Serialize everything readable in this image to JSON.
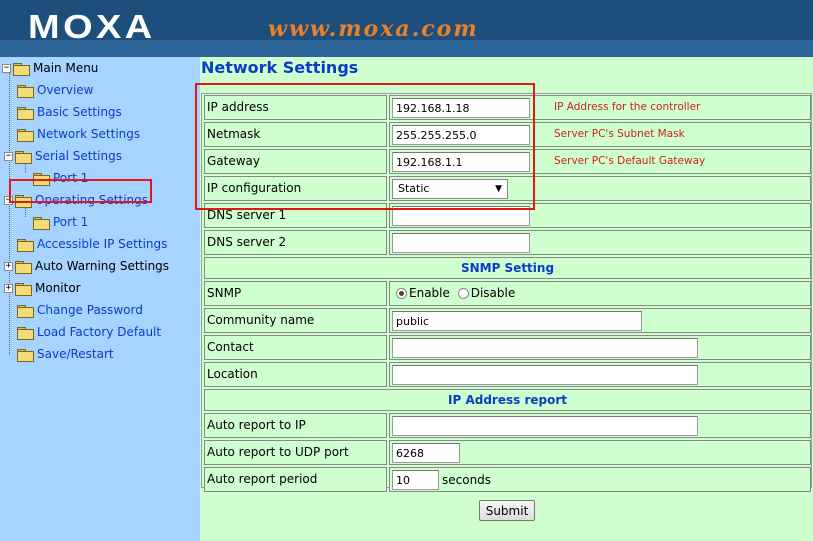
{
  "header": {
    "logo_text": "MOXA",
    "site_url": "www.moxa.com"
  },
  "sidebar": {
    "root": "Main Menu",
    "items": [
      {
        "label": "Overview"
      },
      {
        "label": "Basic Settings"
      },
      {
        "label": "Network Settings"
      },
      {
        "label": "Serial Settings"
      },
      {
        "label": "Port 1"
      },
      {
        "label": "Operating Settings"
      },
      {
        "label": "Port 1"
      },
      {
        "label": "Accessible IP Settings"
      },
      {
        "label": "Auto Warning Settings"
      },
      {
        "label": "Monitor"
      },
      {
        "label": "Change Password"
      },
      {
        "label": "Load Factory Default"
      },
      {
        "label": "Save/Restart"
      }
    ]
  },
  "main": {
    "title": "Network Settings",
    "rows": [
      {
        "label": "IP address",
        "value": "192.168.1.18",
        "hint": "IP Address for the controller"
      },
      {
        "label": "Netmask",
        "value": "255.255.255.0",
        "hint": "Server PC's Subnet Mask"
      },
      {
        "label": "Gateway",
        "value": "192.168.1.1",
        "hint": "Server PC's Default Gateway"
      },
      {
        "label": "IP configuration",
        "value": "Static"
      },
      {
        "label": "DNS server 1",
        "value": ""
      },
      {
        "label": "DNS server 2",
        "value": ""
      }
    ],
    "snmp_section": "SNMP Setting",
    "snmp": {
      "label": "SNMP",
      "enable_label": "Enable",
      "disable_label": "Disable",
      "selected": "Enable"
    },
    "snmp_rows": [
      {
        "label": "Community name",
        "value": "public"
      },
      {
        "label": "Contact",
        "value": ""
      },
      {
        "label": "Location",
        "value": ""
      }
    ],
    "report_section": "IP Address report",
    "report_rows": [
      {
        "label": "Auto report to IP",
        "value": ""
      },
      {
        "label": "Auto report to UDP port",
        "value": "6268"
      },
      {
        "label": "Auto report period",
        "value": "10",
        "unit": "seconds"
      }
    ],
    "submit_label": "Submit"
  },
  "colors": {
    "header_bg": "#1e4f7c",
    "sidebar_bg": "#a6d3ff",
    "content_bg": "#cfffcf",
    "link": "#0b3cc8",
    "hint": "#cc1f1f",
    "highlight": "#e01818"
  }
}
